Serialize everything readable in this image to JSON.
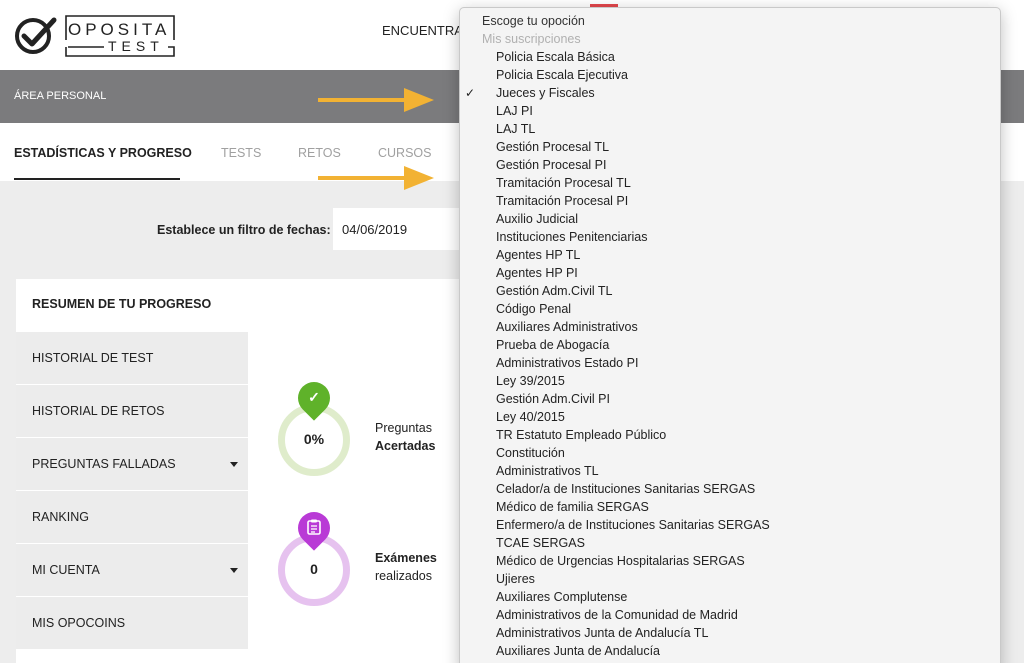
{
  "header": {
    "logo_top": "OPOSITA",
    "logo_bottom": "TEST",
    "nav_link": "ENCUENTRA"
  },
  "area_bar": {
    "label": "ÁREA PERSONAL"
  },
  "tabs": [
    {
      "label": "ESTADÍSTICAS Y PROGRESO",
      "active": true
    },
    {
      "label": "TESTS",
      "active": false
    },
    {
      "label": "RETOS",
      "active": false
    },
    {
      "label": "CURSOS",
      "active": false
    }
  ],
  "filter": {
    "label": "Establece un filtro de fechas:",
    "value": "04/06/2019"
  },
  "panel": {
    "title": "RESUMEN DE TU PROGRESO",
    "menu": [
      {
        "label": "HISTORIAL DE TEST",
        "has_caret": false
      },
      {
        "label": "HISTORIAL DE RETOS",
        "has_caret": false
      },
      {
        "label": "PREGUNTAS FALLADAS",
        "has_caret": true
      },
      {
        "label": "RANKING",
        "has_caret": false
      },
      {
        "label": "MI CUENTA",
        "has_caret": true
      },
      {
        "label": "MIS OPOCOINS",
        "has_caret": false
      }
    ]
  },
  "stats": [
    {
      "value": "0%",
      "line1": "Preguntas",
      "line2": "Acertadas",
      "bold_line": 2,
      "ring_color": "#dfeccb",
      "pin_color": "#5fb22a",
      "icon": "check-icon"
    },
    {
      "value": "0",
      "line1": "Exámenes",
      "line2": "realizados",
      "bold_line": 1,
      "ring_color": "#e6c2ef",
      "pin_color": "#b93ad6",
      "icon": "clipboard-icon"
    }
  ],
  "dropdown": {
    "header": "Escoge tu opoción",
    "group_label": "Mis suscripciones",
    "selected_index": 2,
    "options": [
      "Policia Escala Básica",
      "Policia Escala Ejecutiva",
      "Jueces y Fiscales",
      "LAJ PI",
      "LAJ TL",
      "Gestión Procesal TL",
      "Gestión Procesal PI",
      "Tramitación Procesal TL",
      "Tramitación Procesal PI",
      "Auxilio Judicial",
      "Instituciones Penitenciarias",
      "Agentes HP TL",
      "Agentes HP PI",
      "Gestión Adm.Civil TL",
      "Código Penal",
      "Auxiliares Administrativos",
      "Prueba de Abogacía",
      "Administrativos Estado PI",
      "Ley 39/2015",
      "Gestión Adm.Civil PI",
      "Ley 40/2015",
      "TR Estatuto Empleado Público",
      "Constitución",
      "Administrativos TL",
      "Celador/a de Instituciones Sanitarias SERGAS",
      "Médico de familia SERGAS",
      "Enfermero/a de Instituciones Sanitarias SERGAS",
      "TCAE SERGAS",
      "Médico de Urgencias Hospitalarias SERGAS",
      "Ujieres",
      "Auxiliares Complutense",
      "Administrativos de la Comunidad de Madrid",
      "Administrativos Junta de Andalucía TL",
      "Auxiliares Junta de Andalucía"
    ]
  },
  "colors": {
    "arrow": "#f2b233",
    "area_bar": "#7b7b7d",
    "accent_red": "#e2474c"
  }
}
